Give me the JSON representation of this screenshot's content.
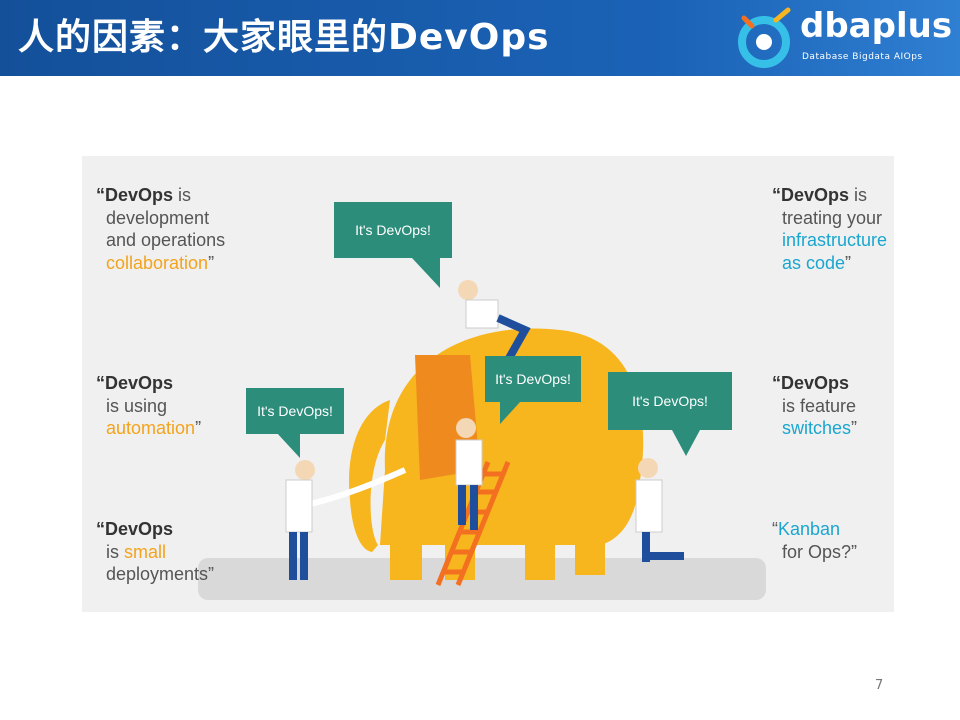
{
  "header": {
    "title": "人的因素：大家眼里的DevOps"
  },
  "logo": {
    "name": "dbaplus",
    "tagline": "Database Bigdata AIOps"
  },
  "quotes": {
    "q1": {
      "l1": "“DevOps",
      "l1b": " is",
      "l2": "development",
      "l3": "and operations",
      "l4a": "collaboration",
      "l4b": "”"
    },
    "q2": {
      "l1": "“DevOps",
      "l2": "is using",
      "l3a": "automation",
      "l3b": "”"
    },
    "q3": {
      "l1": "“DevOps",
      "l2a": "is ",
      "l2b": "small",
      "l3": "deployments”"
    },
    "q4": {
      "l1": "“DevOps",
      "l1b": " is",
      "l2": "treating your",
      "l3": "infrastructure",
      "l4a": "as code",
      "l4b": "”"
    },
    "q5": {
      "l1": "“DevOps",
      "l2": "is feature",
      "l3a": "switches",
      "l3b": "”"
    },
    "q6": {
      "l1a": "“",
      "l1b": "Kanban",
      "l2": "for Ops?”"
    }
  },
  "bubbles": {
    "b1": "It's DevOps!",
    "b2": "It's DevOps!",
    "b3": "It's DevOps!",
    "b4": "It's DevOps!"
  },
  "colors": {
    "header_blue": "#1b63b7",
    "elephant": "#f7b51e",
    "bubble": "#2b8d7a",
    "orange_text": "#f3a31c",
    "blue_text": "#1aa6cf"
  },
  "page_number": "7"
}
